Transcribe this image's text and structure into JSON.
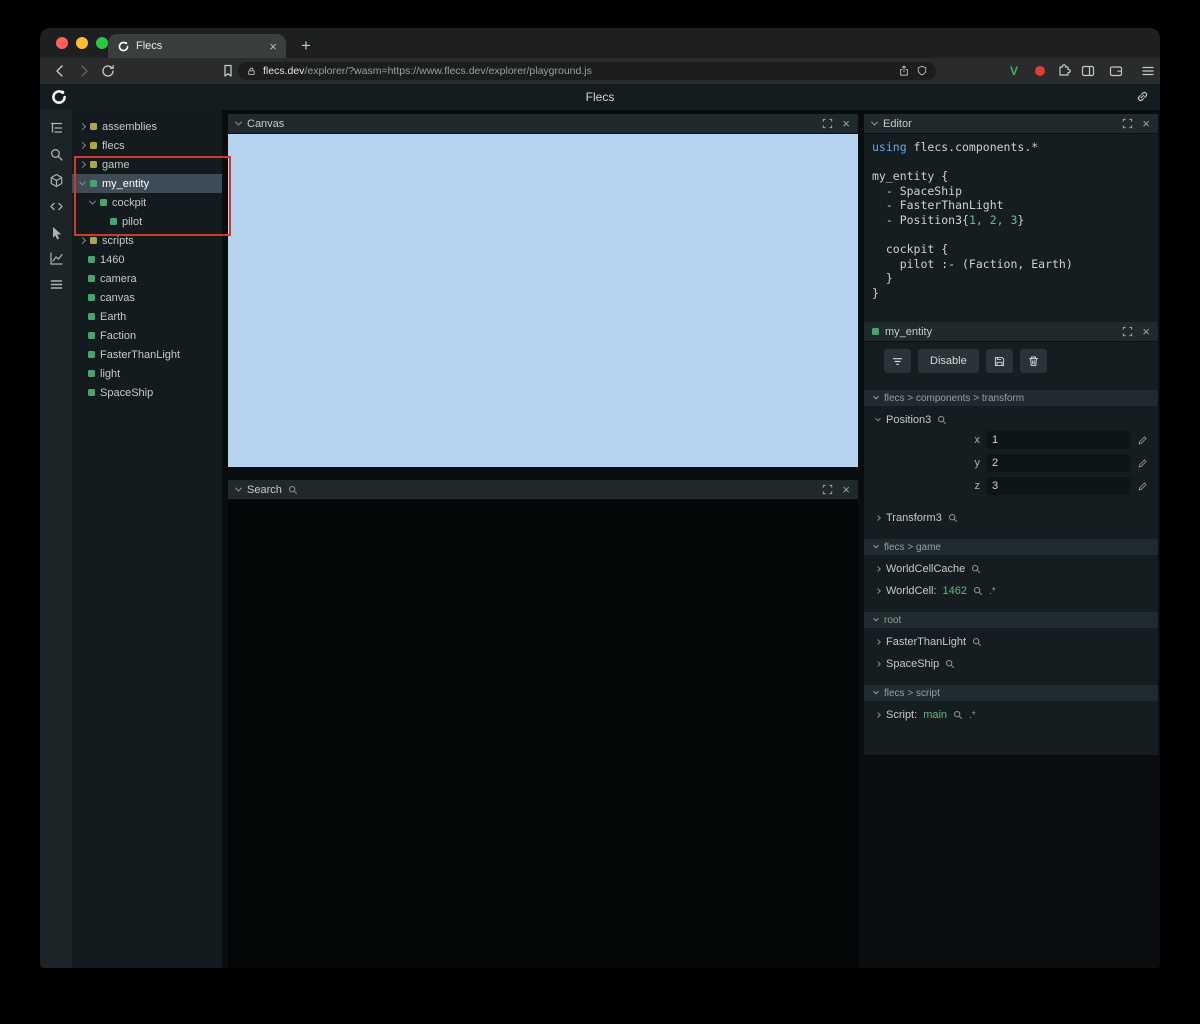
{
  "browser": {
    "tab_title": "Flecs",
    "close_tab": "×",
    "new_tab": "+",
    "url_domain": "flecs.dev",
    "url_path": "/explorer/?wasm=https://www.flecs.dev/explorer/playground.js",
    "v_extension": "V"
  },
  "app": {
    "title": "Flecs"
  },
  "tree": {
    "items": [
      {
        "label": "assemblies",
        "kind": "module"
      },
      {
        "label": "flecs",
        "kind": "module"
      },
      {
        "label": "game",
        "kind": "module"
      },
      {
        "label": "my_entity",
        "kind": "entity",
        "selected": true
      },
      {
        "label": "cockpit",
        "kind": "entity"
      },
      {
        "label": "pilot",
        "kind": "entity"
      },
      {
        "label": "scripts",
        "kind": "module"
      },
      {
        "label": "1460",
        "kind": "entity"
      },
      {
        "label": "camera",
        "kind": "entity"
      },
      {
        "label": "canvas",
        "kind": "entity"
      },
      {
        "label": "Earth",
        "kind": "entity"
      },
      {
        "label": "Faction",
        "kind": "entity"
      },
      {
        "label": "FasterThanLight",
        "kind": "entity"
      },
      {
        "label": "light",
        "kind": "entity"
      },
      {
        "label": "SpaceShip",
        "kind": "entity"
      }
    ]
  },
  "panels": {
    "canvas": {
      "title": "Canvas"
    },
    "search": {
      "title": "Search"
    },
    "editor": {
      "title": "Editor"
    },
    "inspector": {
      "title": "my_entity"
    }
  },
  "editor_code": [
    {
      "kw": "using ",
      "rest": "flecs.components.*"
    },
    {
      "plain": ""
    },
    {
      "plain": "my_entity {"
    },
    {
      "plain": "  - SpaceShip"
    },
    {
      "plain": "  - FasterThanLight"
    },
    {
      "pre": "  - Position3{",
      "num": "1, 2, 3",
      "post": "}"
    },
    {
      "plain": ""
    },
    {
      "plain": "  cockpit {"
    },
    {
      "plain": "    pilot :- (Faction, Earth)"
    },
    {
      "plain": "  }"
    },
    {
      "plain": "}"
    }
  ],
  "inspector": {
    "disable_button": "Disable",
    "sections": {
      "transform": "flecs > components > transform",
      "game": "flecs > game",
      "root": "root",
      "script": "flecs > script"
    },
    "position3": {
      "name": "Position3",
      "fields": [
        {
          "label": "x",
          "value": "1"
        },
        {
          "label": "y",
          "value": "2"
        },
        {
          "label": "z",
          "value": "3"
        }
      ]
    },
    "transform3": "Transform3",
    "worldcellcache": "WorldCellCache",
    "worldcell": {
      "name": "WorldCell:",
      "value": "1462",
      "suffix": ".*"
    },
    "fasterthanlight": "FasterThanLight",
    "spaceship": "SpaceShip",
    "script": {
      "name": "Script:",
      "value": "main",
      "suffix": ".*"
    }
  },
  "colors": {
    "entity_green": "#43a66f",
    "module_yellow": "#b0a53f",
    "selection": "#3d4c56",
    "canvas_blue": "#b6d3f0",
    "annotation_red": "#ce3b2b",
    "value_green": "#5cb879"
  }
}
